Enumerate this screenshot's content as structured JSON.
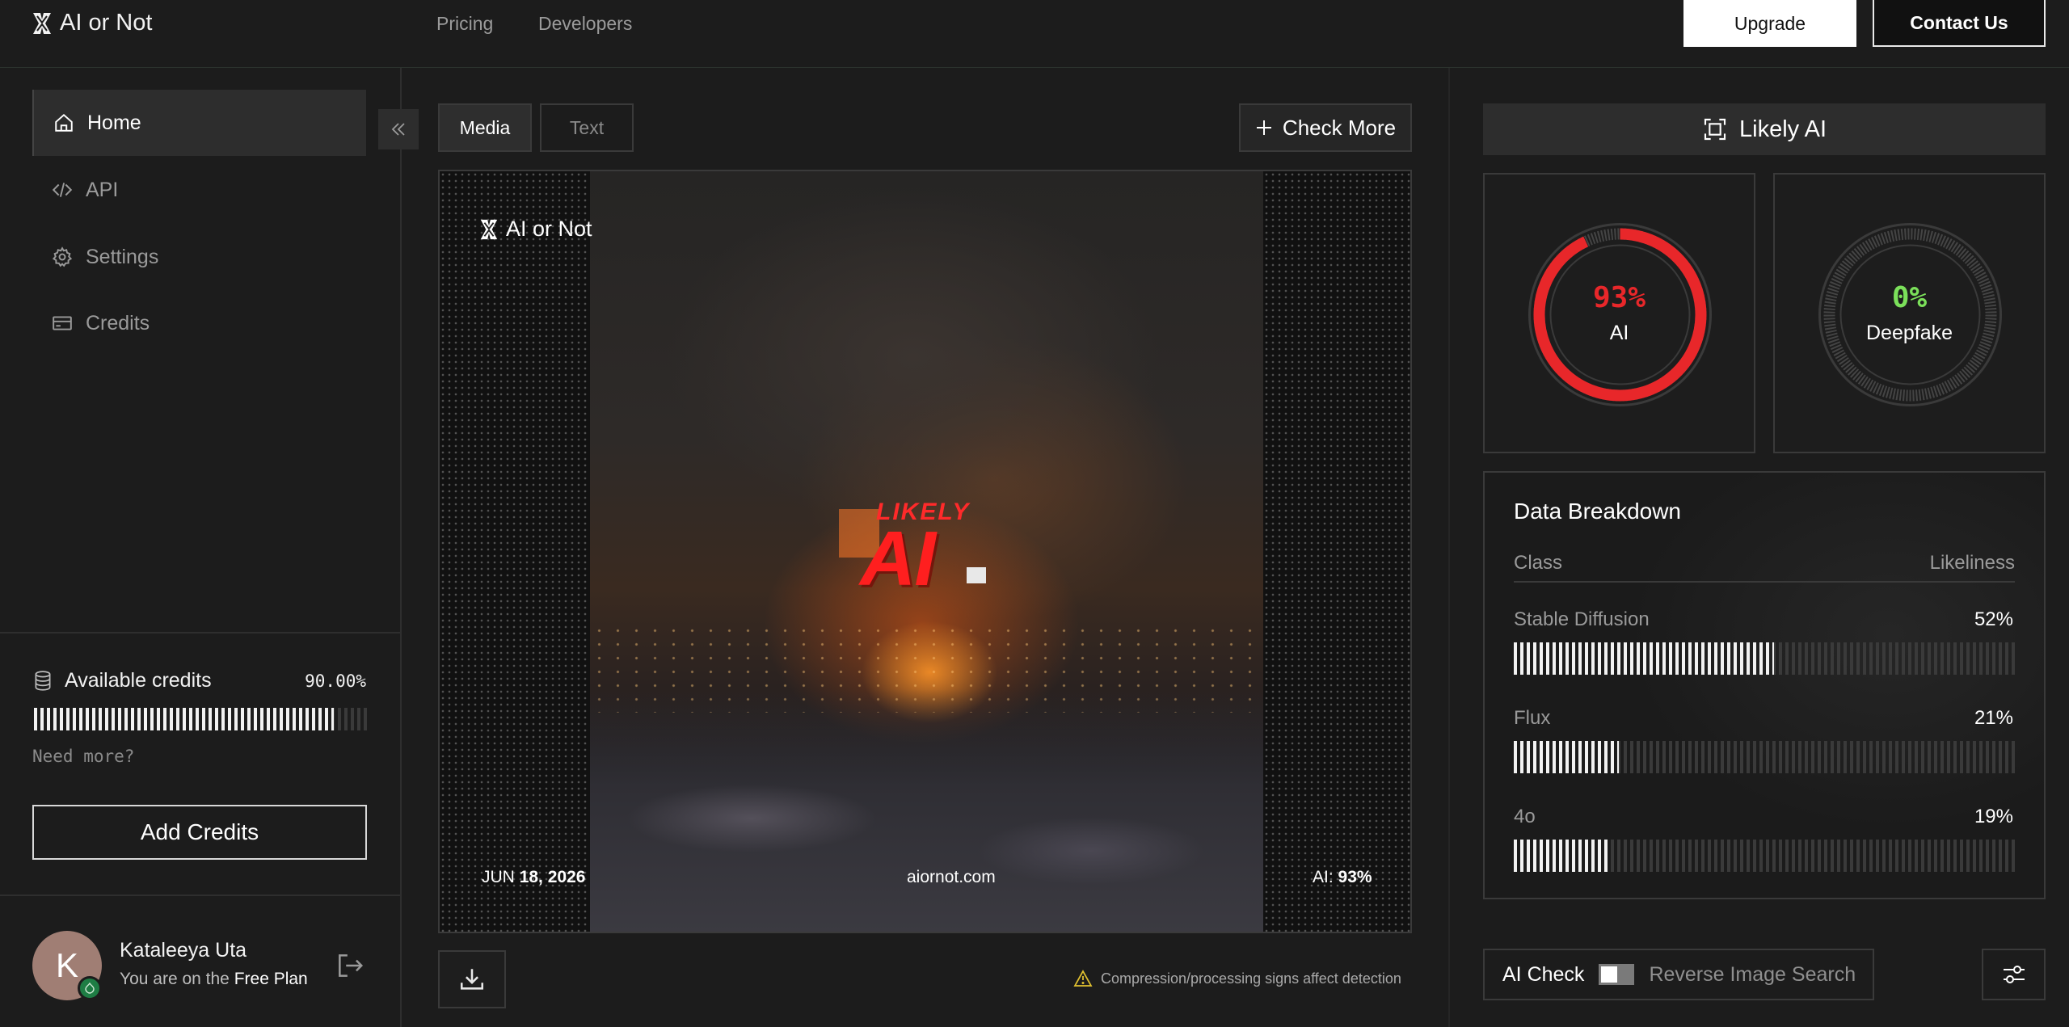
{
  "app": {
    "name": "AI or Not"
  },
  "topnav": {
    "links": [
      "Pricing",
      "Developers"
    ],
    "upgrade_label": "Upgrade",
    "contact_label": "Contact Us"
  },
  "sidebar": {
    "items": [
      {
        "label": "Home",
        "icon": "home-icon",
        "active": true
      },
      {
        "label": "API",
        "icon": "code-icon",
        "active": false
      },
      {
        "label": "Settings",
        "icon": "gear-icon",
        "active": false
      },
      {
        "label": "Credits",
        "icon": "credit-card-icon",
        "active": false
      }
    ],
    "credits": {
      "label": "Available credits",
      "percent_text": "90.00%",
      "fraction": 0.9,
      "need_more": "Need more?",
      "add_label": "Add Credits"
    },
    "user": {
      "initial": "K",
      "name": "Kataleeya Uta",
      "plan_prefix": "You are on the",
      "plan": "Free Plan"
    }
  },
  "center": {
    "tabs": [
      {
        "label": "Media",
        "active": true
      },
      {
        "label": "Text",
        "active": false
      }
    ],
    "check_more_label": "Check More",
    "image": {
      "watermark_logo": "AI or Not",
      "stamp_small": "LIKELY",
      "stamp_big": "AI",
      "date_prefix": "JUN",
      "date_main": "18, 2026",
      "site": "aiornot.com",
      "ai_prefix": "AI:",
      "ai_value": "93%"
    },
    "warning": "Compression/processing signs affect detection"
  },
  "right": {
    "verdict": "Likely AI",
    "gauges": [
      {
        "pct_text": "93%",
        "value": 0.93,
        "label": "AI",
        "color": "#e8272a"
      },
      {
        "pct_text": "0%",
        "value": 0.0,
        "label": "Deepfake",
        "color": "#7be05a"
      }
    ],
    "breakdown": {
      "title": "Data Breakdown",
      "col_class": "Class",
      "col_likeliness": "Likeliness",
      "rows": [
        {
          "label": "Stable Diffusion",
          "pct_text": "52%",
          "fraction": 0.52
        },
        {
          "label": "Flux",
          "pct_text": "21%",
          "fraction": 0.21
        },
        {
          "label": "4o",
          "pct_text": "19%",
          "fraction": 0.19
        }
      ]
    },
    "mode": {
      "ai_check": "AI Check",
      "reverse": "Reverse Image Search"
    }
  },
  "colors": {
    "bg": "#1c1c1c",
    "ai_red": "#e8272a",
    "deepfake_green": "#7be05a",
    "warning_yellow": "#e0c030"
  }
}
